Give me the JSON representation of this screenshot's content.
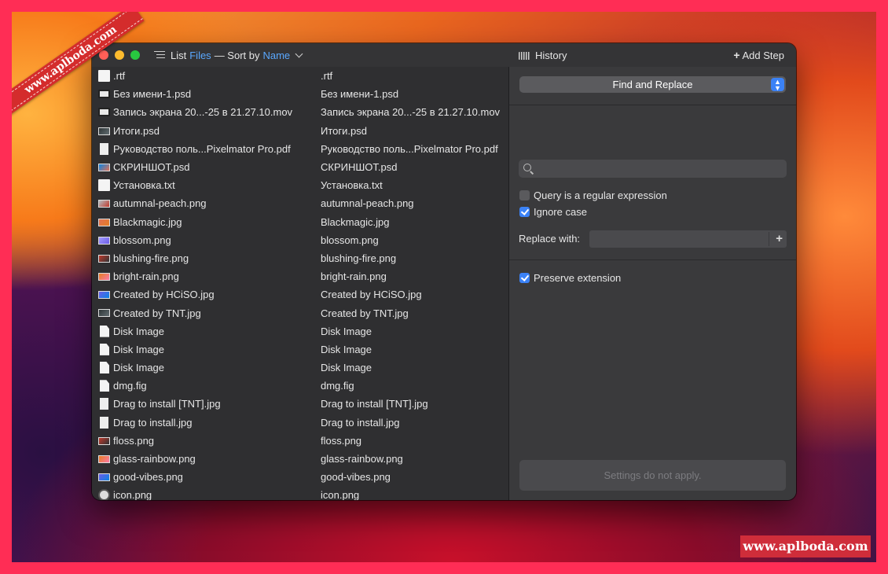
{
  "watermark": {
    "ribbon": "www.aplboda.com",
    "badge": "www.aplboda.com"
  },
  "titlebar": {
    "list_label": "List",
    "files_label": "Files",
    "dash_sort": "— Sort by",
    "sort_value": "Name",
    "history_label": "History",
    "add_step_label": "Add Step"
  },
  "files": [
    {
      "icon": "doc",
      "original": ".rtf",
      "renamed": ".rtf"
    },
    {
      "icon": "film",
      "original": "Без имени-1.psd",
      "renamed": "Без имени-1.psd"
    },
    {
      "icon": "film",
      "original": "Запись экрана 20...-25 в 21.27.10.mov",
      "renamed": "Запись экрана 20...-25 в 21.27.10.mov"
    },
    {
      "icon": "img",
      "original": "Итоги.psd",
      "renamed": "Итоги.psd"
    },
    {
      "icon": "pdf",
      "original": "Руководство поль...Pixelmator Pro.pdf",
      "renamed": "Руководство поль...Pixelmator Pro.pdf"
    },
    {
      "icon": "img",
      "original": "СКРИНШОТ.psd",
      "renamed": "СКРИНШОТ.psd"
    },
    {
      "icon": "doc",
      "original": "Установка.txt",
      "renamed": "Установка.txt"
    },
    {
      "icon": "img",
      "original": "autumnal-peach.png",
      "renamed": "autumnal-peach.png"
    },
    {
      "icon": "img",
      "original": "Blackmagic.jpg",
      "renamed": "Blackmagic.jpg"
    },
    {
      "icon": "img",
      "original": "blossom.png",
      "renamed": "blossom.png"
    },
    {
      "icon": "img",
      "original": "blushing-fire.png",
      "renamed": "blushing-fire.png"
    },
    {
      "icon": "img",
      "original": "bright-rain.png",
      "renamed": "bright-rain.png"
    },
    {
      "icon": "img",
      "original": "Created by HCiSO.jpg",
      "renamed": "Created by HCiSO.jpg"
    },
    {
      "icon": "img",
      "original": "Created by TNT.jpg",
      "renamed": "Created by TNT.jpg"
    },
    {
      "icon": "page",
      "original": "Disk Image",
      "renamed": "Disk Image"
    },
    {
      "icon": "page",
      "original": "Disk Image",
      "renamed": "Disk Image"
    },
    {
      "icon": "page",
      "original": "Disk Image",
      "renamed": "Disk Image"
    },
    {
      "icon": "page",
      "original": "dmg.fig",
      "renamed": "dmg.fig"
    },
    {
      "icon": "pdf",
      "original": "Drag to install [TNT].jpg",
      "renamed": "Drag to install [TNT].jpg"
    },
    {
      "icon": "pdf",
      "original": "Drag to install.jpg",
      "renamed": "Drag to install.jpg"
    },
    {
      "icon": "img",
      "original": "floss.png",
      "renamed": "floss.png"
    },
    {
      "icon": "img",
      "original": "glass-rainbow.png",
      "renamed": "glass-rainbow.png"
    },
    {
      "icon": "img",
      "original": "good-vibes.png",
      "renamed": "good-vibes.png"
    },
    {
      "icon": "round",
      "original": "icon.png",
      "renamed": "icon.png"
    }
  ],
  "thumb_colors": [
    "#c0392b",
    "#e67e22",
    "#6c5ce7",
    "#2d3436",
    "#fd79a8",
    "#0984e3",
    "#636e72",
    "#b2bec3",
    "#e17055",
    "#a29bfe"
  ],
  "step": {
    "name": "Find and Replace",
    "search_value": "",
    "regex_label": "Query is a regular expression",
    "regex_checked": false,
    "ignore_case_label": "Ignore case",
    "ignore_case_checked": true,
    "replace_label": "Replace with:",
    "replace_value": "",
    "preserve_ext_label": "Preserve extension",
    "preserve_ext_checked": true,
    "notice": "Settings do not apply."
  }
}
